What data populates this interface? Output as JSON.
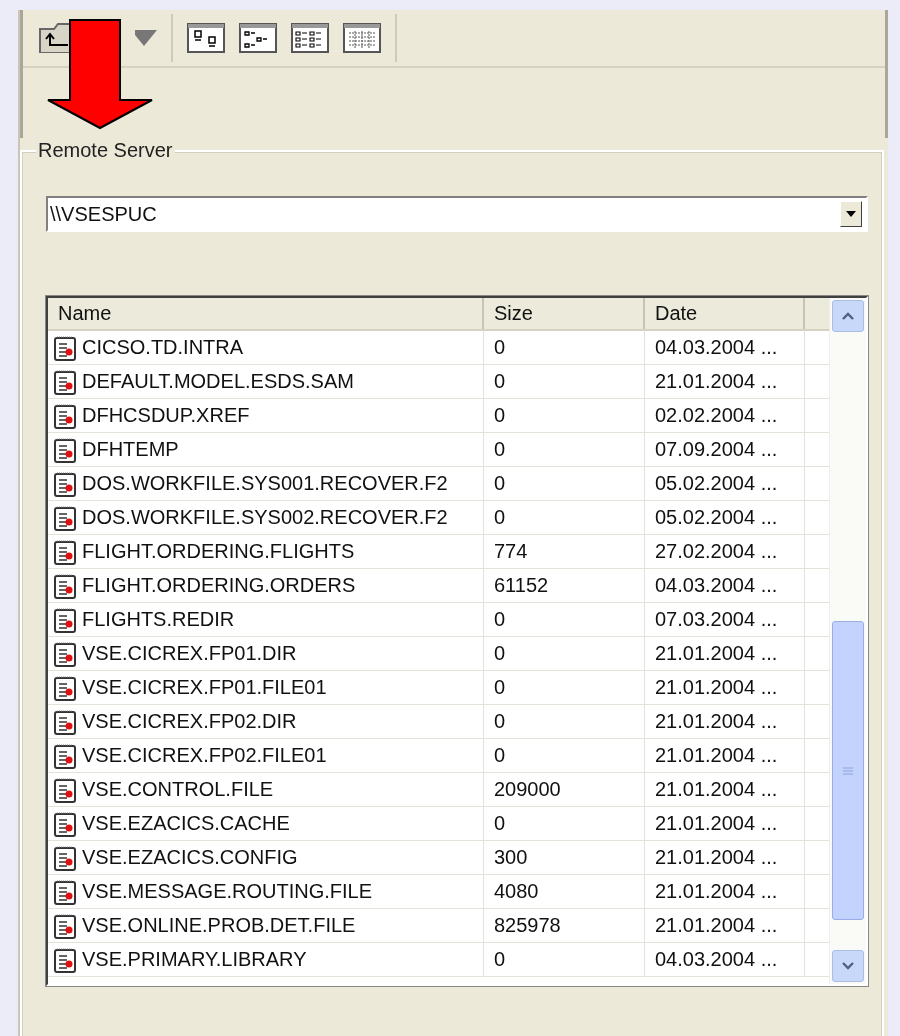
{
  "group": {
    "title": "Remote Server"
  },
  "server": {
    "value": "\\\\VSESPUC"
  },
  "list": {
    "columns": [
      "Name",
      "Size",
      "Date"
    ],
    "rows": [
      {
        "name": "CICSO.TD.INTRA",
        "size": "0",
        "date": "04.03.2004 ..."
      },
      {
        "name": "DEFAULT.MODEL.ESDS.SAM",
        "size": "0",
        "date": "21.01.2004 ..."
      },
      {
        "name": "DFHCSDUP.XREF",
        "size": "0",
        "date": "02.02.2004 ..."
      },
      {
        "name": "DFHTEMP",
        "size": "0",
        "date": "07.09.2004 ..."
      },
      {
        "name": "DOS.WORKFILE.SYS001.RECOVER.F2",
        "size": "0",
        "date": "05.02.2004 ..."
      },
      {
        "name": "DOS.WORKFILE.SYS002.RECOVER.F2",
        "size": "0",
        "date": "05.02.2004 ..."
      },
      {
        "name": "FLIGHT.ORDERING.FLIGHTS",
        "size": "774",
        "date": "27.02.2004 ..."
      },
      {
        "name": "FLIGHT.ORDERING.ORDERS",
        "size": "61152",
        "date": "04.03.2004 ..."
      },
      {
        "name": "FLIGHTS.REDIR",
        "size": "0",
        "date": "07.03.2004 ..."
      },
      {
        "name": "VSE.CICREX.FP01.DIR",
        "size": "0",
        "date": "21.01.2004 ..."
      },
      {
        "name": "VSE.CICREX.FP01.FILE01",
        "size": "0",
        "date": "21.01.2004 ..."
      },
      {
        "name": "VSE.CICREX.FP02.DIR",
        "size": "0",
        "date": "21.01.2004 ..."
      },
      {
        "name": "VSE.CICREX.FP02.FILE01",
        "size": "0",
        "date": "21.01.2004 ..."
      },
      {
        "name": "VSE.CONTROL.FILE",
        "size": "209000",
        "date": "21.01.2004 ..."
      },
      {
        "name": "VSE.EZACICS.CACHE",
        "size": "0",
        "date": "21.01.2004 ..."
      },
      {
        "name": "VSE.EZACICS.CONFIG",
        "size": "300",
        "date": "21.01.2004 ..."
      },
      {
        "name": "VSE.MESSAGE.ROUTING.FILE",
        "size": "4080",
        "date": "21.01.2004 ..."
      },
      {
        "name": "VSE.ONLINE.PROB.DET.FILE",
        "size": "825978",
        "date": "21.01.2004 ..."
      },
      {
        "name": "VSE.PRIMARY.LIBRARY",
        "size": "0",
        "date": "04.03.2004 ..."
      }
    ]
  }
}
